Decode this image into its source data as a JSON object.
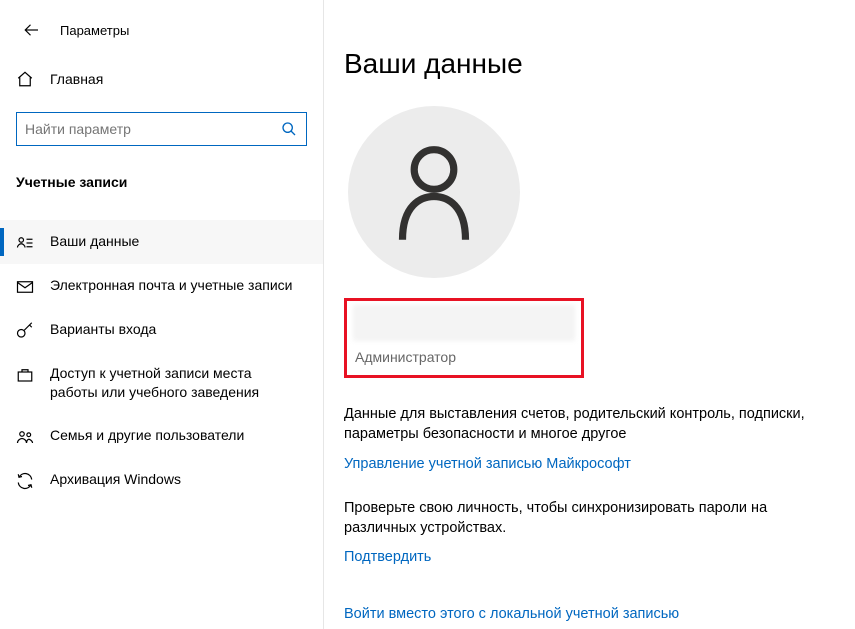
{
  "window": {
    "title": "Параметры"
  },
  "sidebar": {
    "home": "Главная",
    "search_placeholder": "Найти параметр",
    "section": "Учетные записи",
    "items": [
      {
        "label": "Ваши данные"
      },
      {
        "label": "Электронная почта и учетные записи"
      },
      {
        "label": "Варианты входа"
      },
      {
        "label": "Доступ к учетной записи места работы или учебного заведения"
      },
      {
        "label": "Семья и другие пользователи"
      },
      {
        "label": "Архивация Windows"
      }
    ]
  },
  "main": {
    "title": "Ваши данные",
    "role": "Администратор",
    "billing_text": "Данные для выставления счетов, родительский контроль, подписки, параметры безопасности и многое другое",
    "manage_link": "Управление учетной записью Майкрософт",
    "verify_text": "Проверьте свою личность, чтобы синхронизировать пароли на различных устройствах.",
    "verify_link": "Подтвердить",
    "local_link": "Войти вместо этого с локальной учетной записью"
  }
}
